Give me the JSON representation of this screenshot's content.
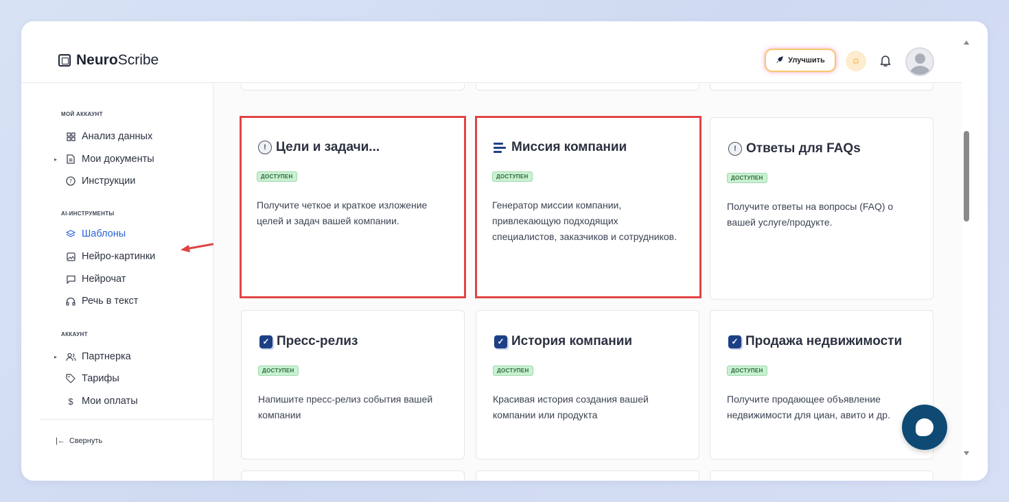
{
  "app": {
    "logo_bold": "Neuro",
    "logo_rest": "Scribe"
  },
  "header": {
    "upgrade_label": "Улучшить"
  },
  "sidebar": {
    "sections": [
      {
        "title": "МОЙ АККАУНТ"
      },
      {
        "title": "AI-ИНСТРУМЕНТЫ"
      },
      {
        "title": "АККАУНТ"
      }
    ],
    "items": [
      {
        "label": "Анализ данных",
        "icon": "dashboard-icon"
      },
      {
        "label": "Мои документы",
        "icon": "document-icon",
        "expandable": true
      },
      {
        "label": "Инструкции",
        "icon": "help-circle-icon"
      },
      {
        "label": "Шаблоны",
        "icon": "layers-icon",
        "active": true
      },
      {
        "label": "Нейро-картинки",
        "icon": "image-icon"
      },
      {
        "label": "Нейрочат",
        "icon": "chat-icon"
      },
      {
        "label": "Речь в текст",
        "icon": "headphones-icon"
      },
      {
        "label": "Партнерка",
        "icon": "users-icon",
        "expandable": true
      },
      {
        "label": "Тарифы",
        "icon": "tag-icon"
      },
      {
        "label": "Мои оплаты",
        "icon": "dollar-icon"
      }
    ],
    "collapse_label": "Свернуть"
  },
  "cards": [
    {
      "title": "Цели и задачи...",
      "badge": "ДОСТУПЕН",
      "description": "Получите четкое и краткое изложение целей и задач вашей компании.",
      "icon": "alert-circle-icon",
      "highlighted": true
    },
    {
      "title": "Миссия компании",
      "badge": "ДОСТУПЕН",
      "description": "Генератор миссии компании, привлекающую подходящих специалистов, заказчиков и сотрудников.",
      "icon": "lines-icon",
      "highlighted": true
    },
    {
      "title": "Ответы для FAQs",
      "badge": "ДОСТУПЕН",
      "description": "Получите ответы на вопросы (FAQ) о вашей услуге/продукте.",
      "icon": "alert-circle-icon",
      "highlighted": false
    },
    {
      "title": "Пресс-релиз",
      "badge": "ДОСТУПЕН",
      "description": "Напишите пресс-релиз события вашей компании",
      "icon": "checkbox-icon",
      "highlighted": false
    },
    {
      "title": "История компании",
      "badge": "ДОСТУПЕН",
      "description": "Красивая история создания вашей компании или продукта",
      "icon": "checkbox-icon",
      "highlighted": false
    },
    {
      "title": "Продажа недвижимости",
      "badge": "ДОСТУПЕН",
      "description": "Получите продающее объявление недвижимости для циан, авито и др.",
      "icon": "checkbox-icon",
      "highlighted": false
    }
  ],
  "colors": {
    "accent": "#2a62d6",
    "highlight_border": "#e04444",
    "badge_bg": "#c9f1d2",
    "chat_button": "#0f4a75"
  }
}
